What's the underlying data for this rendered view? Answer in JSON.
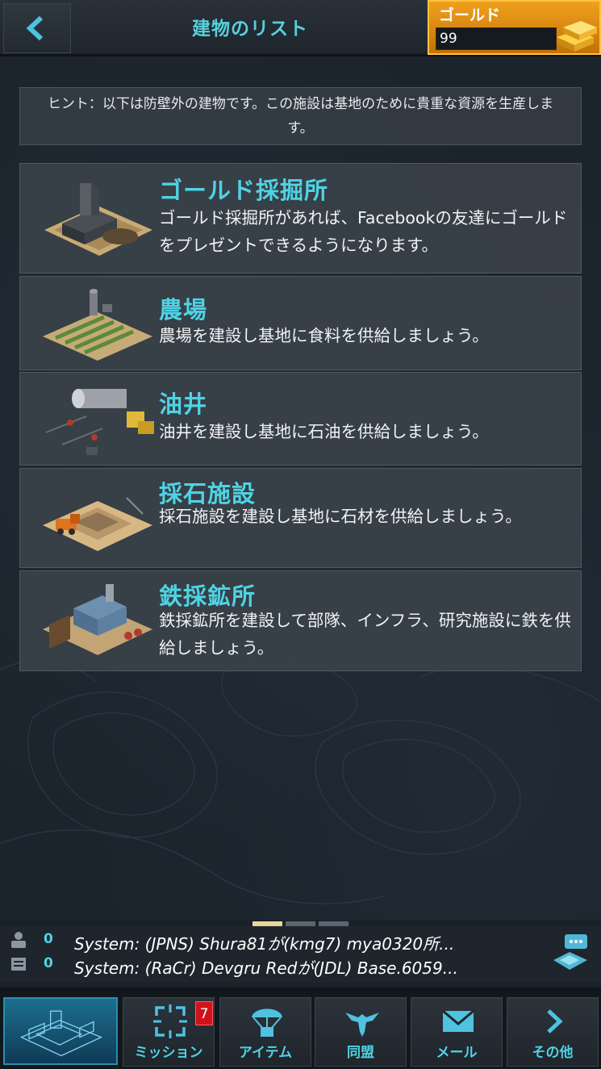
{
  "header": {
    "title": "建物のリスト",
    "gold_label": "ゴールド",
    "gold_value": "99"
  },
  "hint": "ヒント：以下は防壁外の建物です。この施設は基地のために貴重な資源を生産します。",
  "buildings": [
    {
      "name": "ゴールド採掘所",
      "desc": "ゴールド採掘所があれば、Facebookの友達にゴールドをプレゼントできるようになります。"
    },
    {
      "name": "農場",
      "desc": "農場を建設し基地に食料を供給しましょう。"
    },
    {
      "name": "油井",
      "desc": "油井を建設し基地に石油を供給しましょう。"
    },
    {
      "name": "採石施設",
      "desc": "採石施設を建設し基地に石材を供給しましょう。"
    },
    {
      "name": "鉄採鉱所",
      "desc": "鉄採鉱所を建設して部隊、インフラ、研究施設に鉄を供給しましょう。"
    }
  ],
  "chat": {
    "players_count": "0",
    "messages_count": "0",
    "line1": "System: (JPNS) Shura81が(kmg7) mya0320所...",
    "line2": "System: (RaCr) Devgru Redが(JDL) Base.6059..."
  },
  "nav": {
    "mission": "ミッション",
    "mission_badge": "7",
    "items": "アイテム",
    "alliance": "同盟",
    "mail": "メール",
    "more": "その他"
  },
  "colors": {
    "accent": "#4fd3e4",
    "gold": "#f0a01c",
    "badge": "#d0121c"
  }
}
